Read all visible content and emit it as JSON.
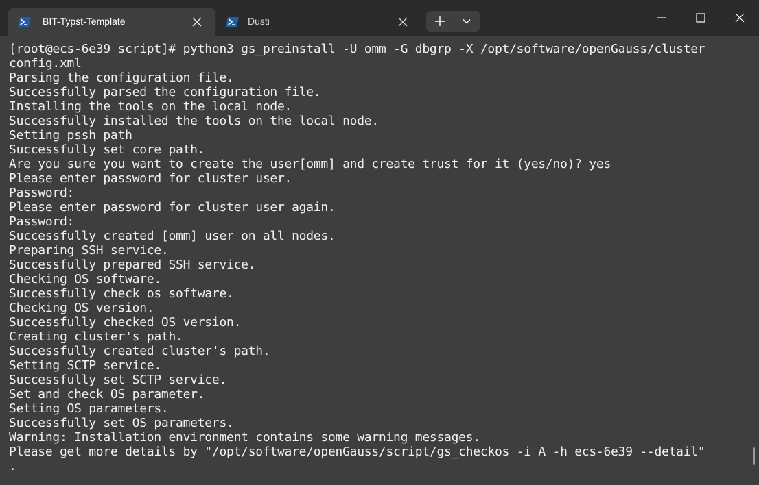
{
  "tabs": [
    {
      "title": "BIT-Typst-Template",
      "icon": "powershell-icon",
      "active": true
    },
    {
      "title": "Dusti",
      "icon": "powershell-icon",
      "active": false
    }
  ],
  "toolbar": {
    "new_tab_icon": "plus-icon",
    "dropdown_icon": "chevron-down-icon"
  },
  "window_controls": [
    "minimize-icon",
    "maximize-icon",
    "close-icon"
  ],
  "colors": {
    "tabbar_bg": "#2b2b2b",
    "active_tab_bg": "#3e3e3e",
    "terminal_bg": "#3c3e40",
    "terminal_fg": "#f0f0f0",
    "powershell_blue": "#2d6cc0"
  },
  "terminal": {
    "lines": [
      "[root@ecs-6e39 script]# python3 gs_preinstall -U omm -G dbgrp -X /opt/software/openGauss/cluster",
      "config.xml",
      "Parsing the configuration file.",
      "Successfully parsed the configuration file.",
      "Installing the tools on the local node.",
      "Successfully installed the tools on the local node.",
      "Setting pssh path",
      "Successfully set core path.",
      "Are you sure you want to create the user[omm] and create trust for it (yes/no)? yes",
      "Please enter password for cluster user.",
      "Password:",
      "Please enter password for cluster user again.",
      "Password:",
      "Successfully created [omm] user on all nodes.",
      "Preparing SSH service.",
      "Successfully prepared SSH service.",
      "Checking OS software.",
      "Successfully check os software.",
      "Checking OS version.",
      "Successfully checked OS version.",
      "Creating cluster's path.",
      "Successfully created cluster's path.",
      "Setting SCTP service.",
      "Successfully set SCTP service.",
      "Set and check OS parameter.",
      "Setting OS parameters.",
      "Successfully set OS parameters.",
      "Warning: Installation environment contains some warning messages.",
      "Please get more details by \"/opt/software/openGauss/script/gs_checkos -i A -h ecs-6e39 --detail\"",
      "."
    ]
  }
}
